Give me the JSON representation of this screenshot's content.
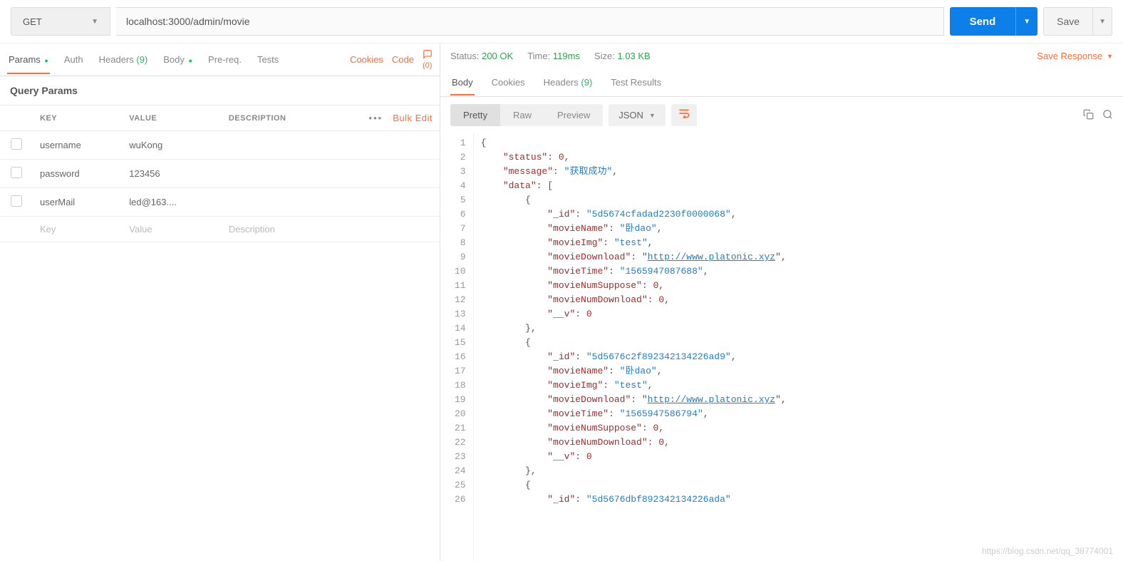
{
  "request": {
    "method": "GET",
    "url": "localhost:3000/admin/movie",
    "send_label": "Send",
    "save_label": "Save"
  },
  "req_tabs": {
    "params": "Params",
    "auth": "Auth",
    "headers": "Headers",
    "headers_count": "(9)",
    "body": "Body",
    "prereq": "Pre-req.",
    "tests": "Tests",
    "cookies": "Cookies",
    "code": "Code",
    "comments_count": "(0)"
  },
  "query_params": {
    "title": "Query Params",
    "bulk_edit": "Bulk Edit",
    "cols": {
      "key": "KEY",
      "value": "VALUE",
      "desc": "DESCRIPTION"
    },
    "rows": [
      {
        "key": "username",
        "value": "wuKong",
        "desc": ""
      },
      {
        "key": "password",
        "value": "123456",
        "desc": ""
      },
      {
        "key": "userMail",
        "value": "led@163....",
        "desc": ""
      }
    ],
    "placeholders": {
      "key": "Key",
      "value": "Value",
      "desc": "Description"
    }
  },
  "response": {
    "status_lbl": "Status:",
    "status_val": "200 OK",
    "time_lbl": "Time:",
    "time_val": "119ms",
    "size_lbl": "Size:",
    "size_val": "1.03 KB",
    "save_label": "Save Response"
  },
  "resp_tabs": {
    "body": "Body",
    "cookies": "Cookies",
    "headers": "Headers",
    "headers_count": "(9)",
    "tests": "Test Results"
  },
  "view": {
    "pretty": "Pretty",
    "raw": "Raw",
    "preview": "Preview",
    "format": "JSON"
  },
  "json_body": {
    "lines": [
      {
        "n": 1,
        "i": 0,
        "t": [
          {
            "c": "brace",
            "v": "{"
          }
        ]
      },
      {
        "n": 2,
        "i": 1,
        "t": [
          {
            "c": "key",
            "v": "\"status\""
          },
          {
            "c": "punc",
            "v": ": "
          },
          {
            "c": "num",
            "v": "0"
          },
          {
            "c": "punc",
            "v": ","
          }
        ]
      },
      {
        "n": 3,
        "i": 1,
        "t": [
          {
            "c": "key",
            "v": "\"message\""
          },
          {
            "c": "punc",
            "v": ": "
          },
          {
            "c": "str",
            "v": "\"获取成功\""
          },
          {
            "c": "punc",
            "v": ","
          }
        ]
      },
      {
        "n": 4,
        "i": 1,
        "t": [
          {
            "c": "key",
            "v": "\"data\""
          },
          {
            "c": "punc",
            "v": ": ["
          }
        ]
      },
      {
        "n": 5,
        "i": 2,
        "t": [
          {
            "c": "brace",
            "v": "{"
          }
        ]
      },
      {
        "n": 6,
        "i": 3,
        "t": [
          {
            "c": "key",
            "v": "\"_id\""
          },
          {
            "c": "punc",
            "v": ": "
          },
          {
            "c": "str",
            "v": "\"5d5674cfadad2230f0000068\""
          },
          {
            "c": "punc",
            "v": ","
          }
        ]
      },
      {
        "n": 7,
        "i": 3,
        "t": [
          {
            "c": "key",
            "v": "\"movieName\""
          },
          {
            "c": "punc",
            "v": ": "
          },
          {
            "c": "str",
            "v": "\"卧dao\""
          },
          {
            "c": "punc",
            "v": ","
          }
        ]
      },
      {
        "n": 8,
        "i": 3,
        "t": [
          {
            "c": "key",
            "v": "\"movieImg\""
          },
          {
            "c": "punc",
            "v": ": "
          },
          {
            "c": "str",
            "v": "\"test\""
          },
          {
            "c": "punc",
            "v": ","
          }
        ]
      },
      {
        "n": 9,
        "i": 3,
        "t": [
          {
            "c": "key",
            "v": "\"movieDownload\""
          },
          {
            "c": "punc",
            "v": ": \""
          },
          {
            "c": "link",
            "v": "http://www.platonic.xyz"
          },
          {
            "c": "punc",
            "v": "\","
          }
        ]
      },
      {
        "n": 10,
        "i": 3,
        "t": [
          {
            "c": "key",
            "v": "\"movieTime\""
          },
          {
            "c": "punc",
            "v": ": "
          },
          {
            "c": "str",
            "v": "\"1565947087688\""
          },
          {
            "c": "punc",
            "v": ","
          }
        ]
      },
      {
        "n": 11,
        "i": 3,
        "t": [
          {
            "c": "key",
            "v": "\"movieNumSuppose\""
          },
          {
            "c": "punc",
            "v": ": "
          },
          {
            "c": "num",
            "v": "0"
          },
          {
            "c": "punc",
            "v": ","
          }
        ]
      },
      {
        "n": 12,
        "i": 3,
        "t": [
          {
            "c": "key",
            "v": "\"movieNumDownload\""
          },
          {
            "c": "punc",
            "v": ": "
          },
          {
            "c": "num",
            "v": "0"
          },
          {
            "c": "punc",
            "v": ","
          }
        ]
      },
      {
        "n": 13,
        "i": 3,
        "t": [
          {
            "c": "key",
            "v": "\"__v\""
          },
          {
            "c": "punc",
            "v": ": "
          },
          {
            "c": "num",
            "v": "0"
          }
        ]
      },
      {
        "n": 14,
        "i": 2,
        "t": [
          {
            "c": "brace",
            "v": "},"
          }
        ]
      },
      {
        "n": 15,
        "i": 2,
        "t": [
          {
            "c": "brace",
            "v": "{"
          }
        ]
      },
      {
        "n": 16,
        "i": 3,
        "t": [
          {
            "c": "key",
            "v": "\"_id\""
          },
          {
            "c": "punc",
            "v": ": "
          },
          {
            "c": "str",
            "v": "\"5d5676c2f892342134226ad9\""
          },
          {
            "c": "punc",
            "v": ","
          }
        ]
      },
      {
        "n": 17,
        "i": 3,
        "t": [
          {
            "c": "key",
            "v": "\"movieName\""
          },
          {
            "c": "punc",
            "v": ": "
          },
          {
            "c": "str",
            "v": "\"卧dao\""
          },
          {
            "c": "punc",
            "v": ","
          }
        ]
      },
      {
        "n": 18,
        "i": 3,
        "t": [
          {
            "c": "key",
            "v": "\"movieImg\""
          },
          {
            "c": "punc",
            "v": ": "
          },
          {
            "c": "str",
            "v": "\"test\""
          },
          {
            "c": "punc",
            "v": ","
          }
        ]
      },
      {
        "n": 19,
        "i": 3,
        "t": [
          {
            "c": "key",
            "v": "\"movieDownload\""
          },
          {
            "c": "punc",
            "v": ": \""
          },
          {
            "c": "link",
            "v": "http://www.platonic.xyz"
          },
          {
            "c": "punc",
            "v": "\","
          }
        ]
      },
      {
        "n": 20,
        "i": 3,
        "t": [
          {
            "c": "key",
            "v": "\"movieTime\""
          },
          {
            "c": "punc",
            "v": ": "
          },
          {
            "c": "str",
            "v": "\"1565947586794\""
          },
          {
            "c": "punc",
            "v": ","
          }
        ]
      },
      {
        "n": 21,
        "i": 3,
        "t": [
          {
            "c": "key",
            "v": "\"movieNumSuppose\""
          },
          {
            "c": "punc",
            "v": ": "
          },
          {
            "c": "num",
            "v": "0"
          },
          {
            "c": "punc",
            "v": ","
          }
        ]
      },
      {
        "n": 22,
        "i": 3,
        "t": [
          {
            "c": "key",
            "v": "\"movieNumDownload\""
          },
          {
            "c": "punc",
            "v": ": "
          },
          {
            "c": "num",
            "v": "0"
          },
          {
            "c": "punc",
            "v": ","
          }
        ]
      },
      {
        "n": 23,
        "i": 3,
        "t": [
          {
            "c": "key",
            "v": "\"__v\""
          },
          {
            "c": "punc",
            "v": ": "
          },
          {
            "c": "num",
            "v": "0"
          }
        ]
      },
      {
        "n": 24,
        "i": 2,
        "t": [
          {
            "c": "brace",
            "v": "},"
          }
        ]
      },
      {
        "n": 25,
        "i": 2,
        "t": [
          {
            "c": "brace",
            "v": "{"
          }
        ]
      },
      {
        "n": 26,
        "i": 3,
        "t": [
          {
            "c": "key",
            "v": "\"_id\""
          },
          {
            "c": "punc",
            "v": ": "
          },
          {
            "c": "str",
            "v": "\"5d5676dbf892342134226ada\""
          }
        ]
      }
    ]
  },
  "watermark": "https://blog.csdn.net/qq_38774001"
}
